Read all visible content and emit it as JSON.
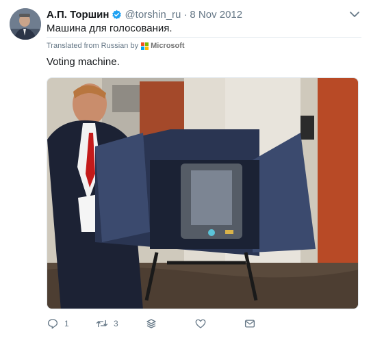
{
  "tweet": {
    "author_name": "А.П. Торшин",
    "handle": "@torshin_ru",
    "separator": "·",
    "date": "8 Nov 2012",
    "text": "Машина для голосования.",
    "translation": {
      "label": "Translated from Russian by",
      "provider": "Microsoft",
      "text": "Voting machine."
    },
    "verified_color": "#1da1f2",
    "actions": {
      "reply_count": "1",
      "retweet_count": "3"
    }
  },
  "icons": [
    "verified-badge-icon",
    "chevron-down-icon",
    "reply-icon",
    "retweet-icon",
    "stack-icon",
    "like-icon",
    "message-icon"
  ],
  "colors": {
    "muted": "#657786",
    "microsoft": [
      "#f25022",
      "#7fba00",
      "#00a4ef",
      "#ffb900"
    ]
  }
}
